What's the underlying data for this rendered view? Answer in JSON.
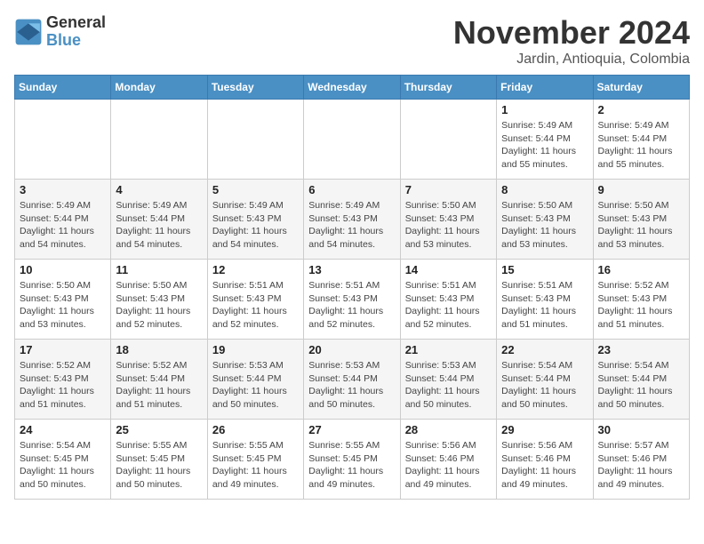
{
  "header": {
    "logo_line1": "General",
    "logo_line2": "Blue",
    "month_title": "November 2024",
    "subtitle": "Jardin, Antioquia, Colombia"
  },
  "weekdays": [
    "Sunday",
    "Monday",
    "Tuesday",
    "Wednesday",
    "Thursday",
    "Friday",
    "Saturday"
  ],
  "weeks": [
    [
      {
        "day": "",
        "info": ""
      },
      {
        "day": "",
        "info": ""
      },
      {
        "day": "",
        "info": ""
      },
      {
        "day": "",
        "info": ""
      },
      {
        "day": "",
        "info": ""
      },
      {
        "day": "1",
        "info": "Sunrise: 5:49 AM\nSunset: 5:44 PM\nDaylight: 11 hours\nand 55 minutes."
      },
      {
        "day": "2",
        "info": "Sunrise: 5:49 AM\nSunset: 5:44 PM\nDaylight: 11 hours\nand 55 minutes."
      }
    ],
    [
      {
        "day": "3",
        "info": "Sunrise: 5:49 AM\nSunset: 5:44 PM\nDaylight: 11 hours\nand 54 minutes."
      },
      {
        "day": "4",
        "info": "Sunrise: 5:49 AM\nSunset: 5:44 PM\nDaylight: 11 hours\nand 54 minutes."
      },
      {
        "day": "5",
        "info": "Sunrise: 5:49 AM\nSunset: 5:43 PM\nDaylight: 11 hours\nand 54 minutes."
      },
      {
        "day": "6",
        "info": "Sunrise: 5:49 AM\nSunset: 5:43 PM\nDaylight: 11 hours\nand 54 minutes."
      },
      {
        "day": "7",
        "info": "Sunrise: 5:50 AM\nSunset: 5:43 PM\nDaylight: 11 hours\nand 53 minutes."
      },
      {
        "day": "8",
        "info": "Sunrise: 5:50 AM\nSunset: 5:43 PM\nDaylight: 11 hours\nand 53 minutes."
      },
      {
        "day": "9",
        "info": "Sunrise: 5:50 AM\nSunset: 5:43 PM\nDaylight: 11 hours\nand 53 minutes."
      }
    ],
    [
      {
        "day": "10",
        "info": "Sunrise: 5:50 AM\nSunset: 5:43 PM\nDaylight: 11 hours\nand 53 minutes."
      },
      {
        "day": "11",
        "info": "Sunrise: 5:50 AM\nSunset: 5:43 PM\nDaylight: 11 hours\nand 52 minutes."
      },
      {
        "day": "12",
        "info": "Sunrise: 5:51 AM\nSunset: 5:43 PM\nDaylight: 11 hours\nand 52 minutes."
      },
      {
        "day": "13",
        "info": "Sunrise: 5:51 AM\nSunset: 5:43 PM\nDaylight: 11 hours\nand 52 minutes."
      },
      {
        "day": "14",
        "info": "Sunrise: 5:51 AM\nSunset: 5:43 PM\nDaylight: 11 hours\nand 52 minutes."
      },
      {
        "day": "15",
        "info": "Sunrise: 5:51 AM\nSunset: 5:43 PM\nDaylight: 11 hours\nand 51 minutes."
      },
      {
        "day": "16",
        "info": "Sunrise: 5:52 AM\nSunset: 5:43 PM\nDaylight: 11 hours\nand 51 minutes."
      }
    ],
    [
      {
        "day": "17",
        "info": "Sunrise: 5:52 AM\nSunset: 5:43 PM\nDaylight: 11 hours\nand 51 minutes."
      },
      {
        "day": "18",
        "info": "Sunrise: 5:52 AM\nSunset: 5:44 PM\nDaylight: 11 hours\nand 51 minutes."
      },
      {
        "day": "19",
        "info": "Sunrise: 5:53 AM\nSunset: 5:44 PM\nDaylight: 11 hours\nand 50 minutes."
      },
      {
        "day": "20",
        "info": "Sunrise: 5:53 AM\nSunset: 5:44 PM\nDaylight: 11 hours\nand 50 minutes."
      },
      {
        "day": "21",
        "info": "Sunrise: 5:53 AM\nSunset: 5:44 PM\nDaylight: 11 hours\nand 50 minutes."
      },
      {
        "day": "22",
        "info": "Sunrise: 5:54 AM\nSunset: 5:44 PM\nDaylight: 11 hours\nand 50 minutes."
      },
      {
        "day": "23",
        "info": "Sunrise: 5:54 AM\nSunset: 5:44 PM\nDaylight: 11 hours\nand 50 minutes."
      }
    ],
    [
      {
        "day": "24",
        "info": "Sunrise: 5:54 AM\nSunset: 5:45 PM\nDaylight: 11 hours\nand 50 minutes."
      },
      {
        "day": "25",
        "info": "Sunrise: 5:55 AM\nSunset: 5:45 PM\nDaylight: 11 hours\nand 50 minutes."
      },
      {
        "day": "26",
        "info": "Sunrise: 5:55 AM\nSunset: 5:45 PM\nDaylight: 11 hours\nand 49 minutes."
      },
      {
        "day": "27",
        "info": "Sunrise: 5:55 AM\nSunset: 5:45 PM\nDaylight: 11 hours\nand 49 minutes."
      },
      {
        "day": "28",
        "info": "Sunrise: 5:56 AM\nSunset: 5:46 PM\nDaylight: 11 hours\nand 49 minutes."
      },
      {
        "day": "29",
        "info": "Sunrise: 5:56 AM\nSunset: 5:46 PM\nDaylight: 11 hours\nand 49 minutes."
      },
      {
        "day": "30",
        "info": "Sunrise: 5:57 AM\nSunset: 5:46 PM\nDaylight: 11 hours\nand 49 minutes."
      }
    ]
  ]
}
